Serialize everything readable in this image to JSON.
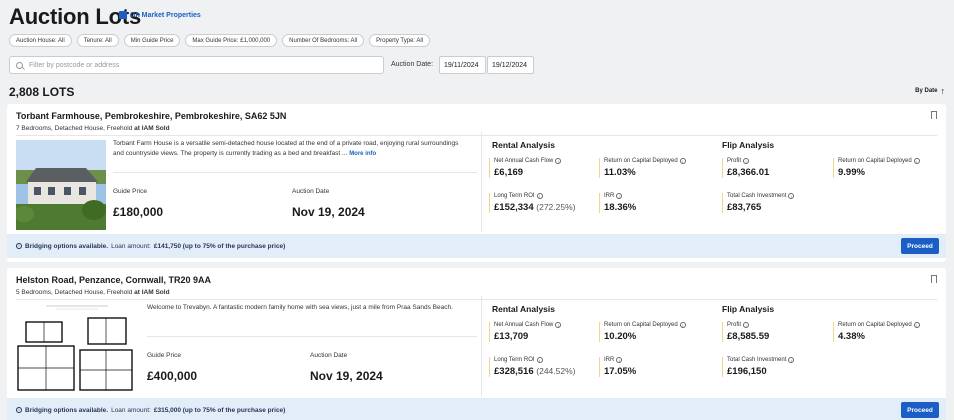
{
  "page": {
    "title": "Auction Lots",
    "on_market": "On Market Properties"
  },
  "filters": [
    "Auction House: All",
    "Tenure: All",
    "Min Guide Price",
    "Max Guide Price: £1,000,000",
    "Number Of Bedrooms: All",
    "Property Type: All"
  ],
  "search": {
    "placeholder": "Filter by postcode or address"
  },
  "auction_date": {
    "label": "Auction Date:",
    "from": "19/11/2024",
    "to": "19/12/2024"
  },
  "lots_count": "2,808 LOTS",
  "sort": {
    "label": "By Date"
  },
  "common": {
    "guide_price": "Guide Price",
    "auction_date": "Auction Date",
    "rental_analysis": "Rental Analysis",
    "flip_analysis": "Flip Analysis",
    "net_annual_cash_flow": "Net Annual Cash Flow",
    "return_on_capital": "Return on Capital Deployed",
    "long_term_roi": "Long Term ROI",
    "irr": "IRR",
    "profit": "Profit",
    "total_cash_investment": "Total Cash Investment",
    "more_info": "More info",
    "proceed": "Proceed",
    "bridging_prefix": "Bridging options available.",
    "loan_label": "Loan amount:"
  },
  "lots": [
    {
      "address": "Torbant Farmhouse, Pembrokeshire, Pembrokeshire, SA62 5JN",
      "details": "7 Bedrooms, Detached House, Freehold",
      "auction_house": "at IAM Sold",
      "description": "Torbant Farm House is a versatile semi-detached house located at the end of a private road, enjoying rural surroundings and countryside views. The property is currently trading as a bed and breakfast ...",
      "guide_price": "£180,000",
      "auction_date": "Nov 19, 2024",
      "rental": {
        "net_annual_cash_flow": "£6,169",
        "return_on_capital": "11.03%",
        "long_term_roi": "£152,334",
        "long_term_roi_pct": "(272.25%)",
        "irr": "18.36%"
      },
      "flip": {
        "profit": "£8,366.01",
        "return_on_capital": "9.99%",
        "total_cash_investment": "£83,765"
      },
      "loan": "£141,750 (up to 75% of the purchase price)"
    },
    {
      "address": "Helston Road, Penzance, Cornwall, TR20 9AA",
      "details": "5 Bedrooms, Detached House, Freehold",
      "auction_house": "at IAM Sold",
      "description": "Welcome to Trevabyn. A fantastic modern family home with sea views, just a mile from Praa Sands Beach.",
      "guide_price": "£400,000",
      "auction_date": "Nov 19, 2024",
      "rental": {
        "net_annual_cash_flow": "£13,709",
        "return_on_capital": "10.20%",
        "long_term_roi": "£328,516",
        "long_term_roi_pct": "(244.52%)",
        "irr": "17.05%"
      },
      "flip": {
        "profit": "£8,585.59",
        "return_on_capital": "4.38%",
        "total_cash_investment": "£196,150"
      },
      "loan": "£315,000 (up to 75% of the purchase price)"
    }
  ]
}
